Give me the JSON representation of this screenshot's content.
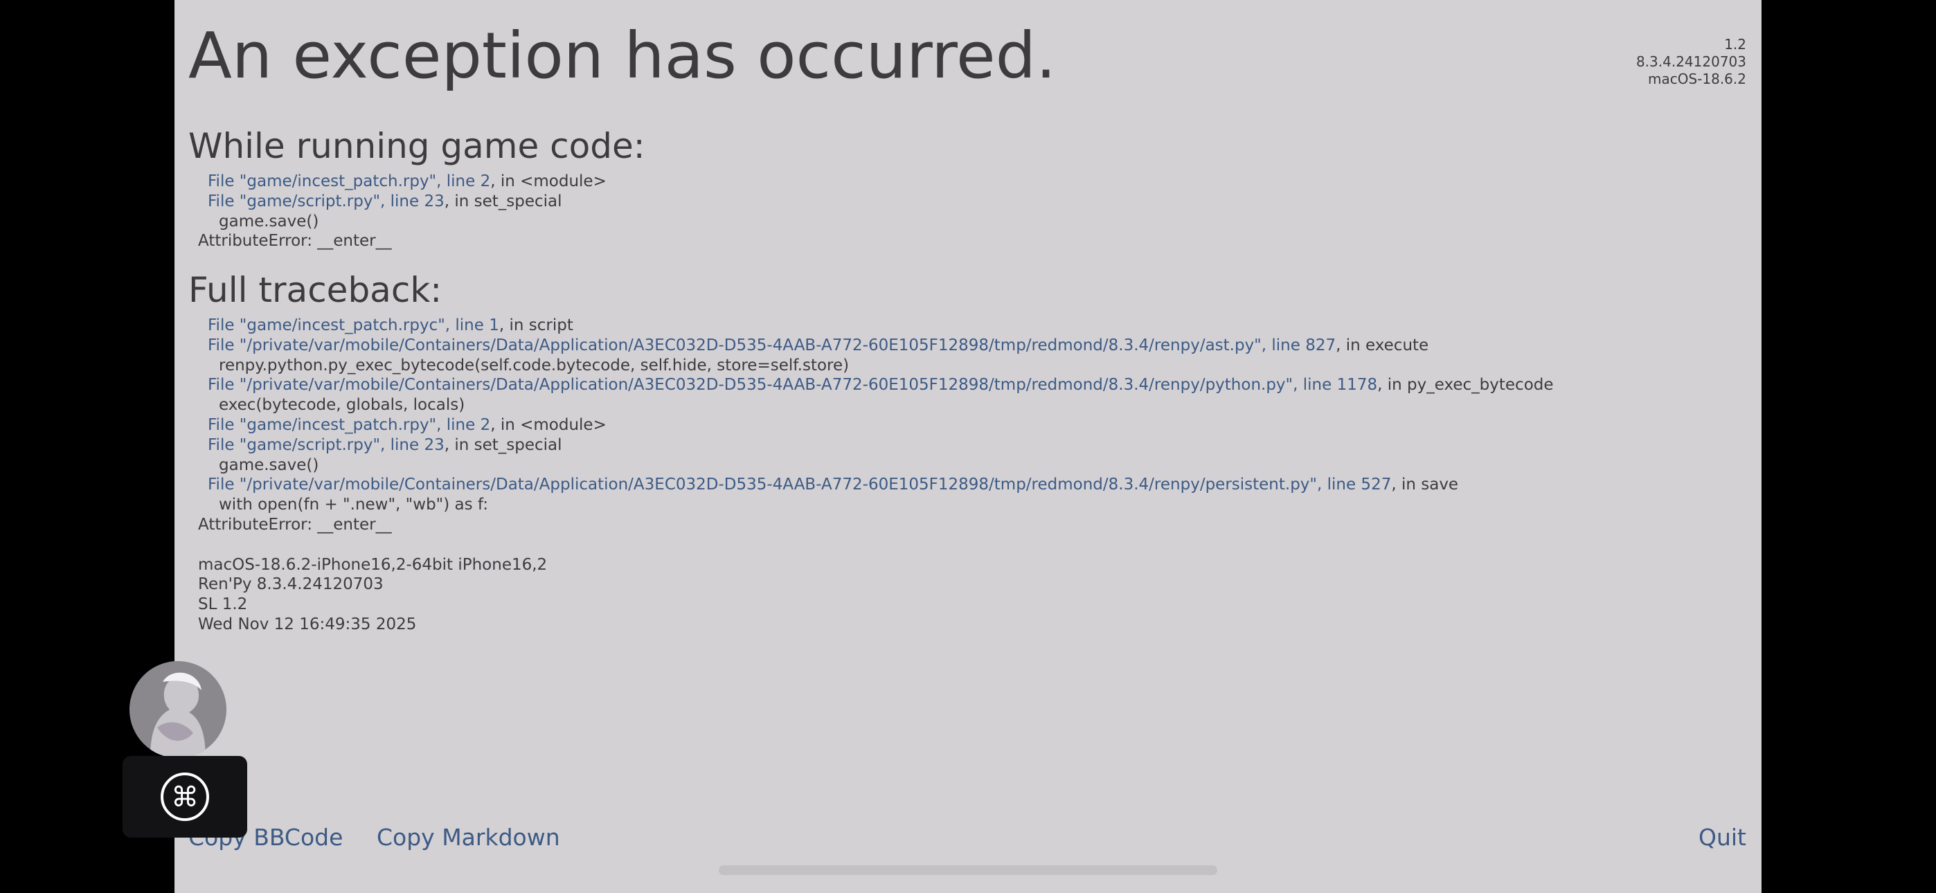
{
  "header": {
    "title": "An exception has occurred.",
    "version_lines": [
      "1.2",
      "8.3.4.24120703",
      "macOS-18.6.2"
    ]
  },
  "short_traceback": {
    "heading": "While running game code:",
    "lines": [
      {
        "kind": "file",
        "link": "File \"game/incest_patch.rpy\", line 2",
        "rest": ", in <module>"
      },
      {
        "kind": "file",
        "link": "File \"game/script.rpy\", line 23",
        "rest": ", in set_special"
      },
      {
        "kind": "code",
        "text": "game.save()"
      },
      {
        "kind": "err",
        "text": "AttributeError: __enter__"
      }
    ]
  },
  "full_traceback": {
    "heading": "Full traceback:",
    "lines": [
      {
        "kind": "file",
        "link": "File \"game/incest_patch.rpyc\", line 1",
        "rest": ", in script"
      },
      {
        "kind": "file",
        "link": "File \"/private/var/mobile/Containers/Data/Application/A3EC032D-D535-4AAB-A772-60E105F12898/tmp/redmond/8.3.4/renpy/ast.py\", line 827",
        "rest": ", in execute"
      },
      {
        "kind": "code",
        "text": "renpy.python.py_exec_bytecode(self.code.bytecode, self.hide, store=self.store)"
      },
      {
        "kind": "file",
        "link": "File \"/private/var/mobile/Containers/Data/Application/A3EC032D-D535-4AAB-A772-60E105F12898/tmp/redmond/8.3.4/renpy/python.py\", line 1178",
        "rest": ", in py_exec_bytecode"
      },
      {
        "kind": "code",
        "text": "exec(bytecode, globals, locals)"
      },
      {
        "kind": "file",
        "link": "File \"game/incest_patch.rpy\", line 2",
        "rest": ", in <module>"
      },
      {
        "kind": "file",
        "link": "File \"game/script.rpy\", line 23",
        "rest": ", in set_special"
      },
      {
        "kind": "code",
        "text": "game.save()"
      },
      {
        "kind": "file",
        "link": "File \"/private/var/mobile/Containers/Data/Application/A3EC032D-D535-4AAB-A772-60E105F12898/tmp/redmond/8.3.4/renpy/persistent.py\", line 527",
        "rest": ", in save"
      },
      {
        "kind": "code",
        "text": "with open(fn + \".new\", \"wb\") as f:"
      },
      {
        "kind": "err",
        "text": "AttributeError: __enter__"
      },
      {
        "kind": "blank",
        "text": ""
      },
      {
        "kind": "info",
        "text": "macOS-18.6.2-iPhone16,2-64bit iPhone16,2"
      },
      {
        "kind": "info",
        "text": "Ren'Py 8.3.4.24120703"
      },
      {
        "kind": "info",
        "text": "SL 1.2"
      },
      {
        "kind": "info",
        "text": "Wed Nov 12 16:49:35 2025"
      }
    ]
  },
  "actions": {
    "copy_bbcode": "Copy BBCode",
    "copy_markdown": "Copy Markdown",
    "quit": "Quit"
  },
  "overlay": {
    "avatar_icon": "character-avatar-icon",
    "command_icon": "command-key-icon"
  },
  "colors": {
    "background": "#d3d1d4",
    "text": "#3d3b3e",
    "link": "#3d5a85",
    "letterbox": "#000000"
  }
}
